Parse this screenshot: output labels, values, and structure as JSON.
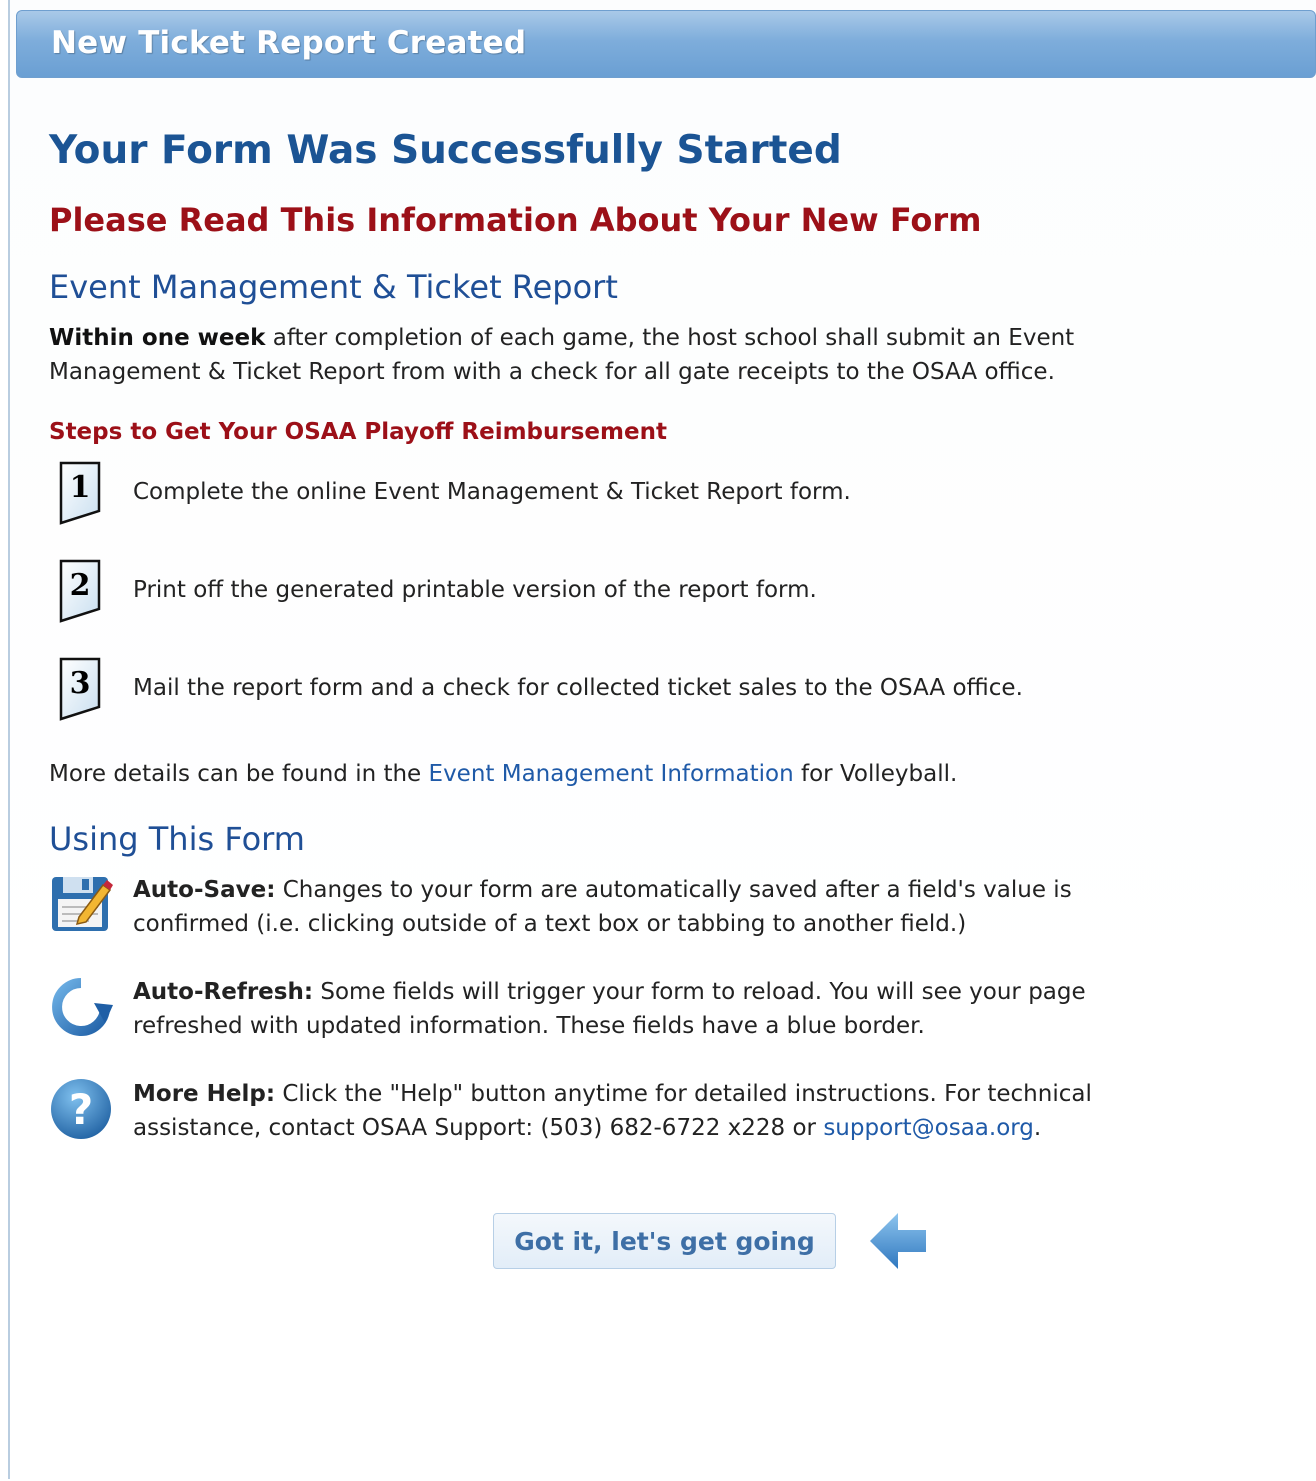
{
  "dialog": {
    "title": "New Ticket Report Created"
  },
  "main": {
    "heading": "Your Form Was Successfully Started",
    "subheading": "Please Read This Information About Your New Form",
    "section1_title": "Event Management & Ticket Report",
    "section1_bold": "Within one week",
    "section1_text_a": " after completion of each game, the host school shall submit an Event",
    "section1_text_b": "Management & Ticket Report from with a check for all gate receipts to the OSAA office.",
    "steps_title": "Steps to Get Your OSAA Playoff Reimbursement",
    "steps": [
      {
        "number": "1",
        "text": "Complete the online Event Management & Ticket Report form."
      },
      {
        "number": "2",
        "text": "Print off the generated printable version of the report form."
      },
      {
        "number": "3",
        "text": "Mail the report form and a check for collected ticket sales to the OSAA office."
      }
    ],
    "details_prefix": "More details can be found in the ",
    "details_link": "Event Management Information",
    "details_suffix": " for Volleyball.",
    "section2_title": "Using This Form",
    "features": [
      {
        "icon": "save-icon",
        "label": "Auto-Save:",
        "line1": " Changes to your form are automatically saved after a field's value is",
        "line2": "confirmed (i.e. clicking outside of a text box or tabbing to another field.)"
      },
      {
        "icon": "refresh-icon",
        "label": "Auto-Refresh:",
        "line1": " Some fields will trigger your form to reload. You will see your page",
        "line2": "refreshed with updated information. These fields have a blue border."
      },
      {
        "icon": "help-icon",
        "label": "More Help:",
        "line1": " Click the \"Help\" button anytime for detailed instructions. For technical",
        "line2a": "assistance, contact OSAA Support: (503) 682-6722 x228 or ",
        "email": "support@osaa.org",
        "line2b": "."
      }
    ],
    "button_label": "Got it, let's get going"
  },
  "colors": {
    "heading_blue": "#1b5494",
    "accent_red": "#9c1018",
    "link_blue": "#1f5aa8",
    "titlebar": "#7eaddb"
  }
}
